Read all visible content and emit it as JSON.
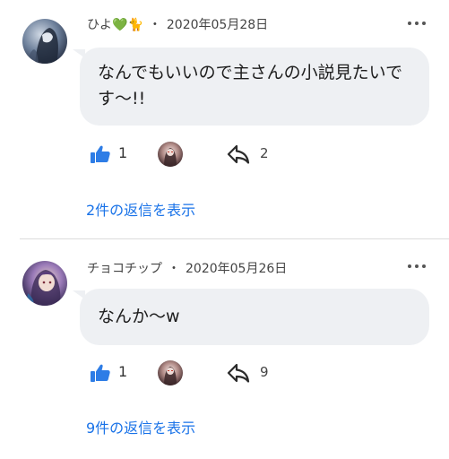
{
  "comments": [
    {
      "author": "ひよ",
      "author_emojis": [
        "💚",
        "🐈"
      ],
      "date": "2020年05月28日",
      "text": "なんでもいいので主さんの小説見たいです〜!!",
      "likes": "1",
      "replies_count": "2",
      "view_replies": "2件の返信を表示"
    },
    {
      "author": "チョコチップ",
      "date": "2020年05月26日",
      "text": "なんか〜w",
      "likes": "1",
      "replies_count": "9",
      "view_replies": "9件の返信を表示"
    }
  ],
  "separator": "・",
  "colors": {
    "accent": "#1a73e8",
    "like_icon": "#2e7de6",
    "bubble_bg": "#eef0f3"
  },
  "icons": {
    "like": "thumbs-up-icon",
    "reply": "reply-icon",
    "more": "more-options-icon"
  }
}
